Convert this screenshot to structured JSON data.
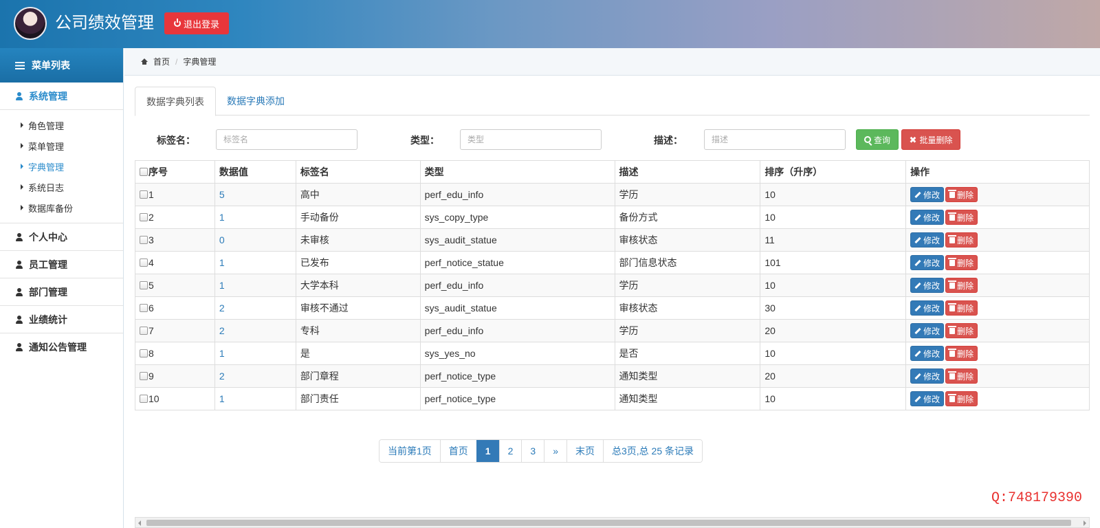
{
  "header": {
    "title": "公司绩效管理",
    "logout_label": "退出登录"
  },
  "sidebar": {
    "menu_title": "菜单列表",
    "groups": [
      {
        "label": "系统管理",
        "items": [
          "角色管理",
          "菜单管理",
          "字典管理",
          "系统日志",
          "数据库备份"
        ],
        "active_item": "字典管理"
      },
      {
        "label": "个人中心"
      },
      {
        "label": "员工管理"
      },
      {
        "label": "部门管理"
      },
      {
        "label": "业绩统计"
      },
      {
        "label": "通知公告管理"
      }
    ]
  },
  "breadcrumb": {
    "home": "首页",
    "current": "字典管理"
  },
  "tabs": [
    {
      "label": "数据字典列表",
      "active": true
    },
    {
      "label": "数据字典添加",
      "active": false
    }
  ],
  "search": {
    "label_name": "标签名：",
    "placeholder_name": "标签名",
    "label_type": "类型：",
    "placeholder_type": "类型",
    "label_desc": "描述：",
    "placeholder_desc": "描述",
    "query_label": "查询",
    "batch_delete_label": "批量删除"
  },
  "table": {
    "headers": [
      "序号",
      "数据值",
      "标签名",
      "类型",
      "描述",
      "排序（升序）",
      "操作"
    ],
    "edit_label": "修改",
    "delete_label": "删除",
    "rows": [
      [
        "1",
        "5",
        "高中",
        "perf_edu_info",
        "学历",
        "10"
      ],
      [
        "2",
        "1",
        "手动备份",
        "sys_copy_type",
        "备份方式",
        "10"
      ],
      [
        "3",
        "0",
        "未审核",
        "sys_audit_statue",
        "审核状态",
        "11"
      ],
      [
        "4",
        "1",
        "已发布",
        "perf_notice_statue",
        "部门信息状态",
        "101"
      ],
      [
        "5",
        "1",
        "大学本科",
        "perf_edu_info",
        "学历",
        "10"
      ],
      [
        "6",
        "2",
        "审核不通过",
        "sys_audit_statue",
        "审核状态",
        "30"
      ],
      [
        "7",
        "2",
        "专科",
        "perf_edu_info",
        "学历",
        "20"
      ],
      [
        "8",
        "1",
        "是",
        "sys_yes_no",
        "是否",
        "10"
      ],
      [
        "9",
        "2",
        "部门章程",
        "perf_notice_type",
        "通知类型",
        "20"
      ],
      [
        "10",
        "1",
        "部门责任",
        "perf_notice_type",
        "通知类型",
        "10"
      ]
    ]
  },
  "pagination": {
    "current_text": "当前第1页",
    "first": "首页",
    "pages": [
      "1",
      "2",
      "3"
    ],
    "current_page": "1",
    "next": "»",
    "last": "末页",
    "summary": "总3页,总 25 条记录"
  },
  "watermark": "Q:748179390",
  "colors": {
    "accent": "#2a8bcb",
    "danger": "#d9534f",
    "success": "#5cb85c",
    "primary": "#337ab7"
  }
}
